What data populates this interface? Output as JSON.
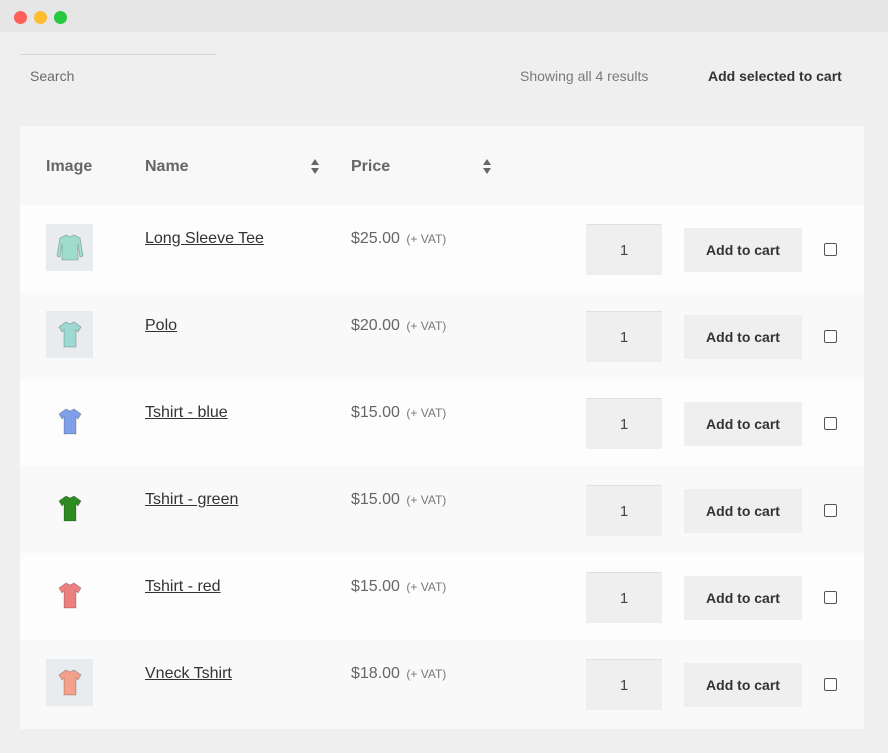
{
  "window": {
    "controls": [
      "close",
      "minimize",
      "maximize"
    ]
  },
  "toolbar": {
    "search_placeholder": "Search",
    "results_text": "Showing all 4 results",
    "add_selected_label": "Add selected to cart"
  },
  "table": {
    "headers": {
      "image": "Image",
      "name": "Name",
      "price": "Price"
    },
    "rows": [
      {
        "name": "Long Sleeve Tee",
        "price": "$25.00",
        "tax": "(+ VAT)",
        "qty": "1",
        "button": "Add to cart",
        "image": "long-sleeve-tee",
        "color": "#9fdccb",
        "checked": false
      },
      {
        "name": "Polo",
        "price": "$20.00",
        "tax": "(+ VAT)",
        "qty": "1",
        "button": "Add to cart",
        "image": "polo",
        "color": "#9ed8d2",
        "checked": false
      },
      {
        "name": "Tshirt - blue",
        "price": "$15.00",
        "tax": "(+ VAT)",
        "qty": "1",
        "button": "Add to cart",
        "image": "tshirt-blue",
        "color": "#7fa0e8",
        "checked": false
      },
      {
        "name": "Tshirt - green",
        "price": "$15.00",
        "tax": "(+ VAT)",
        "qty": "1",
        "button": "Add to cart",
        "image": "tshirt-green",
        "color": "#2e8b22",
        "checked": false
      },
      {
        "name": "Tshirt - red",
        "price": "$15.00",
        "tax": "(+ VAT)",
        "qty": "1",
        "button": "Add to cart",
        "image": "tshirt-red",
        "color": "#ec7f7f",
        "checked": false
      },
      {
        "name": "Vneck Tshirt",
        "price": "$18.00",
        "tax": "(+ VAT)",
        "qty": "1",
        "button": "Add to cart",
        "image": "vneck-tshirt",
        "color": "#f4a08a",
        "checked": false
      }
    ]
  }
}
